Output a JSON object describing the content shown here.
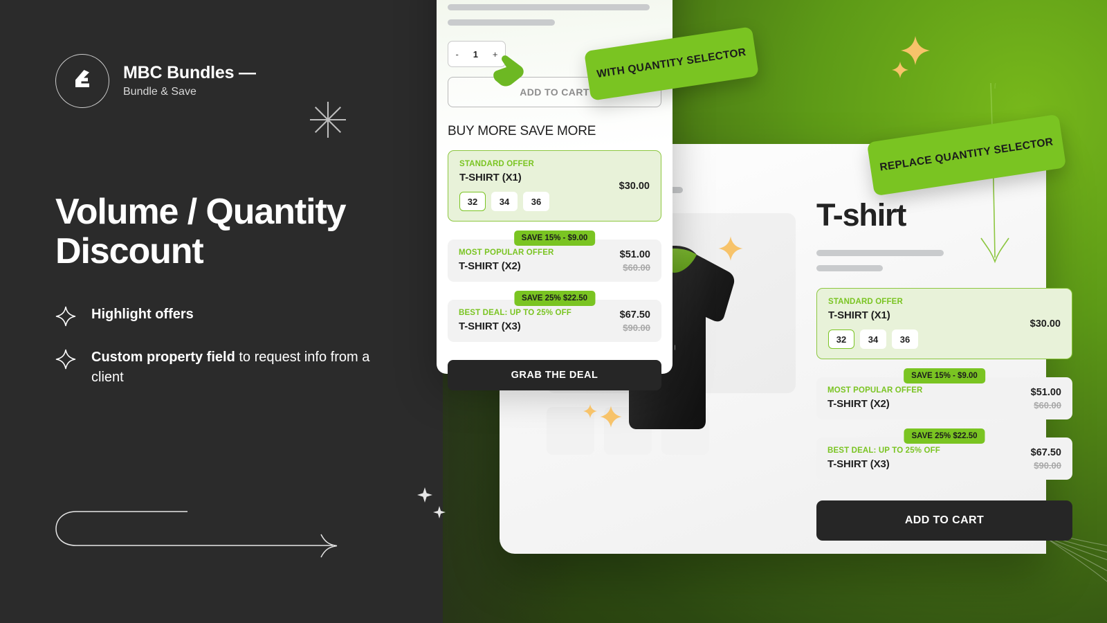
{
  "brand": {
    "title": "MBC Bundles —",
    "subtitle": "Bundle & Save",
    "logo_icon": "mbc-monogram-icon"
  },
  "headline": "Volume /  Quantity Discount",
  "features": [
    {
      "icon": "sparkle-icon",
      "bold": "Highlight offers",
      "rest": ""
    },
    {
      "icon": "sparkle-icon",
      "bold": "Custom property field",
      "rest": " to request info from a client"
    }
  ],
  "callouts": [
    {
      "id": "with-quantity-selector",
      "label": "WITH QUANTITY SELECTOR"
    },
    {
      "id": "replace-quantity-selector",
      "label": "REPLACE QUANTITY SELECTOR"
    }
  ],
  "mobile_card": {
    "quantity": {
      "minus": "-",
      "value": "1",
      "plus": "+"
    },
    "add_to_cart_label": "ADD TO CART",
    "section_heading": "BUY MORE SAVE MORE",
    "cta_label": "GRAB THE DEAL",
    "offers": [
      {
        "label": "STANDARD OFFER",
        "name": "T-SHIRT (X1)",
        "price": "$30.00",
        "compare_at": "",
        "save_badge": "",
        "selected": true,
        "sizes": [
          "32",
          "34",
          "36"
        ],
        "active_size": "32"
      },
      {
        "label": "MOST POPULAR OFFER",
        "name": "T-SHIRT (X2)",
        "price": "$51.00",
        "compare_at": "$60.00",
        "save_badge": "SAVE 15% - $9.00",
        "selected": false,
        "sizes": [],
        "active_size": ""
      },
      {
        "label": "BEST DEAL: UP TO 25% OFF",
        "name": "T-SHIRT (X3)",
        "price": "$67.50",
        "compare_at": "$90.00",
        "save_badge": "SAVE 25% $22.50",
        "selected": false,
        "sizes": [],
        "active_size": ""
      }
    ]
  },
  "desktop_card": {
    "product_title": "T-shirt",
    "breadcrumb_icon": "chevron-right-icon",
    "cta_label": "ADD TO CART",
    "offers": [
      {
        "label": "STANDARD OFFER",
        "name": "T-SHIRT (X1)",
        "price": "$30.00",
        "compare_at": "",
        "save_badge": "",
        "selected": true,
        "sizes": [
          "32",
          "34",
          "36"
        ],
        "active_size": "32"
      },
      {
        "label": "MOST POPULAR OFFER",
        "name": "T-SHIRT (X2)",
        "price": "$51.00",
        "compare_at": "$60.00",
        "save_badge": "SAVE 15% - $9.00",
        "selected": false,
        "sizes": [],
        "active_size": ""
      },
      {
        "label": "BEST DEAL: UP TO 25% OFF",
        "name": "T-SHIRT (X3)",
        "price": "$67.50",
        "compare_at": "$90.00",
        "save_badge": "SAVE 25% $22.50",
        "selected": false,
        "sizes": [],
        "active_size": ""
      }
    ],
    "tshirt_print": "BUNDLES |"
  },
  "colors": {
    "brand_green": "#7ac422",
    "dark_bg": "#2b2b2b",
    "cta_dark": "#262626",
    "sparkle_gold": "#f7c36a",
    "offer_selected_bg": "#e8f2d9"
  },
  "decorations": {
    "asterisk_icon": "asterisk-star-icon",
    "uturn_arrow_icon": "u-turn-arrow-icon",
    "plus_icon": "plus-mark-icon",
    "cursor_icon": "pointing-hand-cursor-icon",
    "connector_icon": "curved-down-arrow-icon"
  }
}
